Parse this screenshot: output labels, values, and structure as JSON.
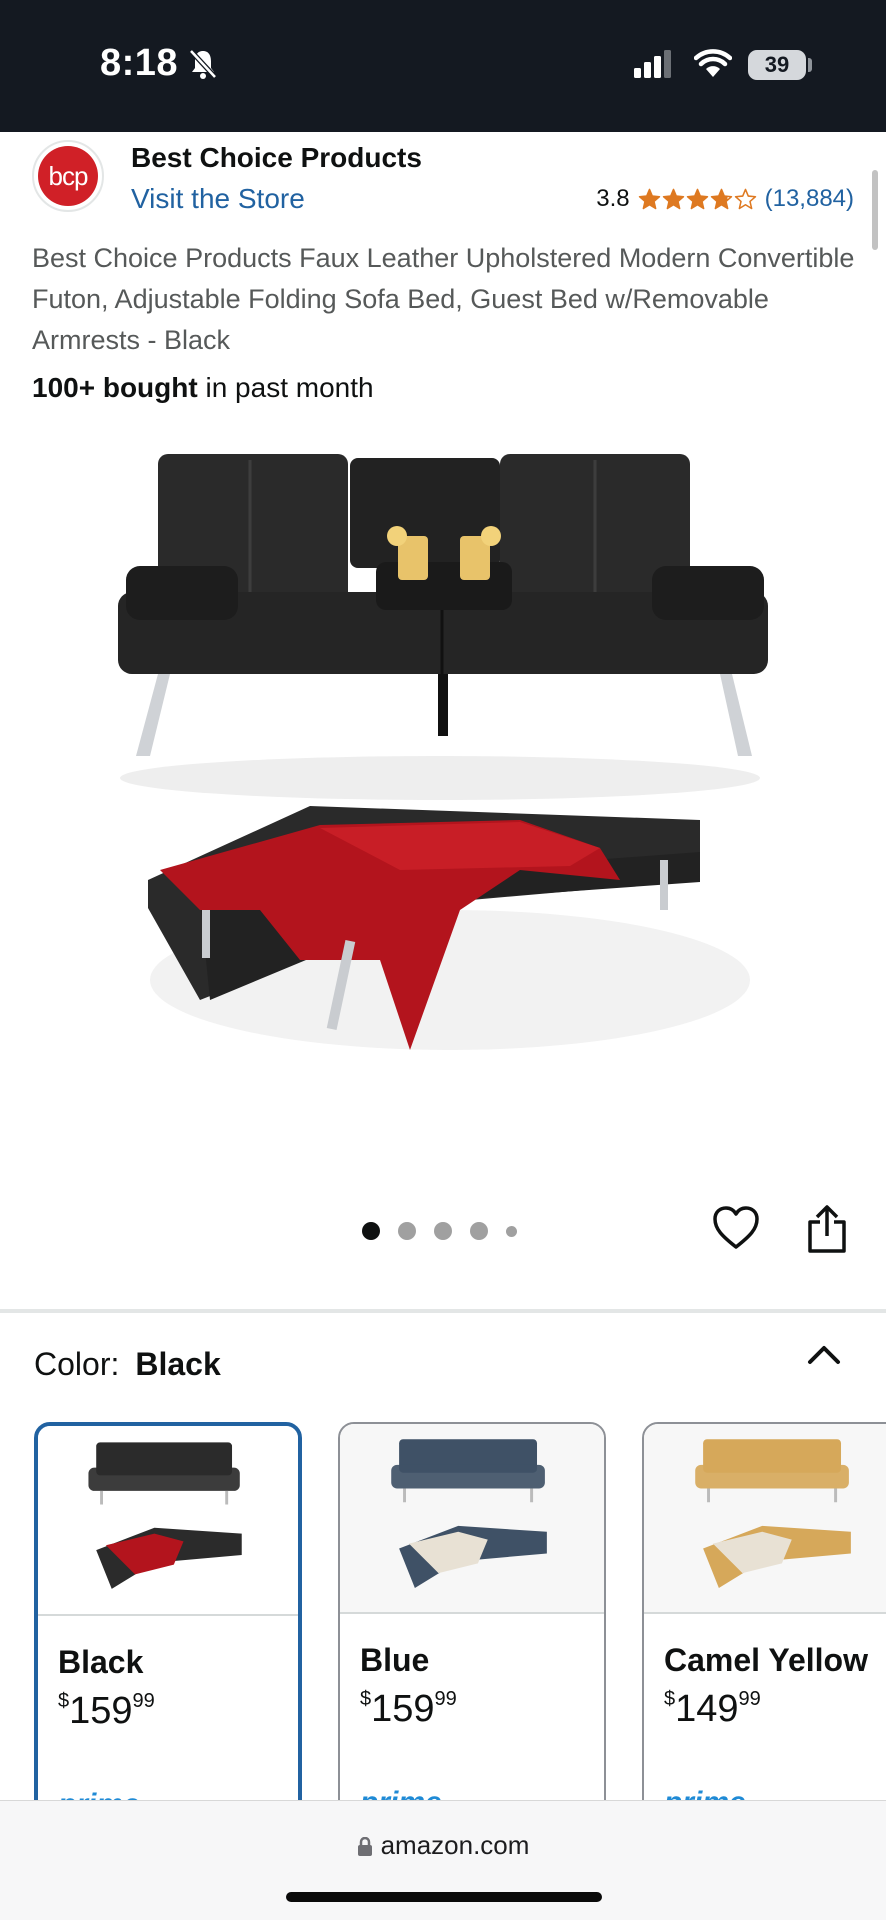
{
  "status_bar": {
    "time": "8:18",
    "battery": "39"
  },
  "brand": {
    "logo_text": "bcp",
    "name": "Best Choice Products",
    "store_link": "Visit the Store"
  },
  "rating": {
    "value": "3.8",
    "stars": 3.8,
    "reviews": "(13,884)",
    "star_color": "#de7921"
  },
  "product": {
    "title": "Best Choice Products Faux Leather Upholstered Modern Convertible Futon, Adjustable Folding Sofa Bed, Guest Bed w/Removable Armrests - Black",
    "bought_bold": "100+ bought",
    "bought_rest": " in past month"
  },
  "gallery": {
    "image_count": 5,
    "active_index": 0
  },
  "color_section": {
    "label": "Color:",
    "selected": "Black"
  },
  "swatches": [
    {
      "name": "Black",
      "price_whole": "159",
      "price_fraction": "99",
      "currency": "$",
      "badge": "prime",
      "color": "#2b2b2b"
    },
    {
      "name": "Blue",
      "price_whole": "159",
      "price_fraction": "99",
      "currency": "$",
      "badge": "prime",
      "color": "#3f5166"
    },
    {
      "name": "Camel Yellow",
      "price_whole": "149",
      "price_fraction": "99",
      "currency": "$",
      "badge": "prime",
      "color": "#d6a85a"
    }
  ],
  "browser": {
    "url": "amazon.com"
  }
}
